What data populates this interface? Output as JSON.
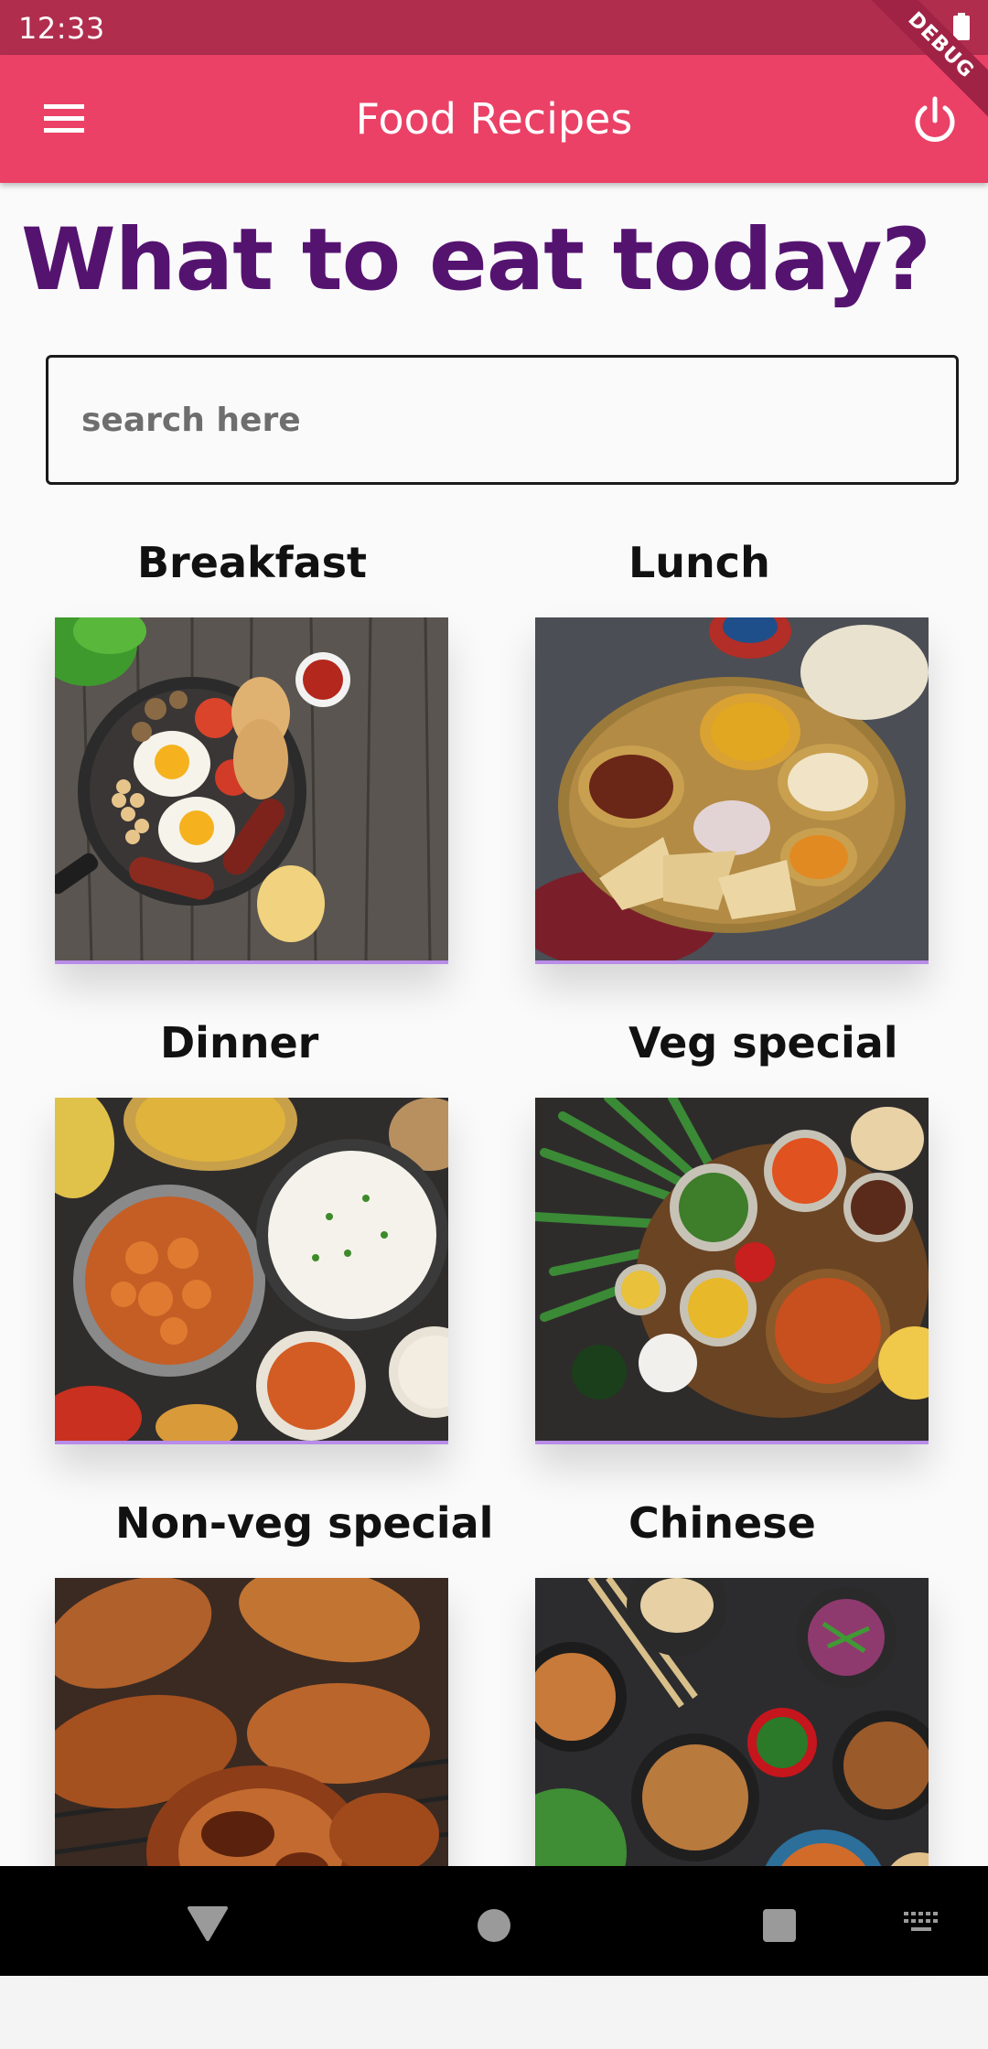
{
  "status_bar": {
    "time": "12:33",
    "debug_label": "DEBUG"
  },
  "app_bar": {
    "title": "Food Recipes",
    "menu_icon": "menu-icon",
    "power_icon": "power-icon",
    "background": "#eb4166"
  },
  "main": {
    "heading": "What to eat today?",
    "heading_color": "#551370",
    "search": {
      "placeholder": "search here",
      "value": ""
    },
    "categories": [
      {
        "label": "Breakfast"
      },
      {
        "label": "Lunch"
      },
      {
        "label": "Dinner"
      },
      {
        "label": "Veg special"
      },
      {
        "label": "Non-veg special"
      },
      {
        "label": "Chinese"
      }
    ]
  },
  "nav_bar": {
    "icons": [
      "back-icon",
      "home-icon",
      "recents-icon",
      "keyboard-icon"
    ]
  }
}
